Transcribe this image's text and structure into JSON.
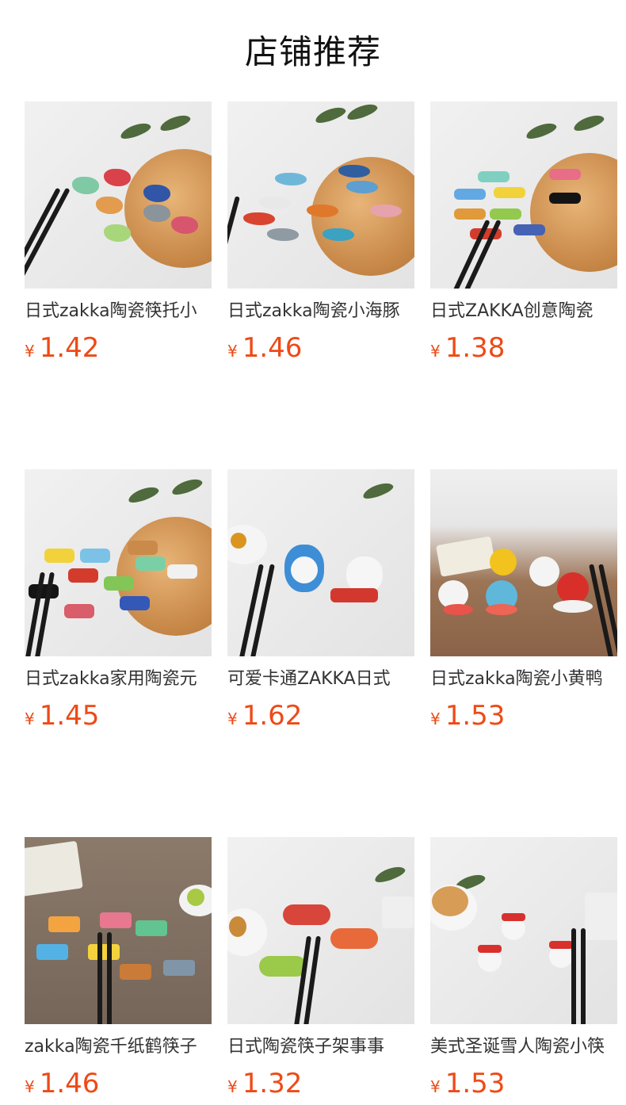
{
  "header": {
    "title": "店铺推荐"
  },
  "currency_symbol": "¥",
  "products": [
    {
      "name": "日式zakka陶瓷筷托小",
      "price": "1.42",
      "image": "fish-chopstick-rests-image",
      "bg": "light"
    },
    {
      "name": "日式zakka陶瓷小海豚",
      "price": "1.46",
      "image": "dolphin-chopstick-rests-image",
      "bg": "light"
    },
    {
      "name": "日式ZAKKA创意陶瓷",
      "price": "1.38",
      "image": "bamboo-chopstick-rests-image",
      "bg": "light"
    },
    {
      "name": "日式zakka家用陶瓷元",
      "price": "1.45",
      "image": "bow-chopstick-rests-image",
      "bg": "light"
    },
    {
      "name": "可爱卡通ZAKKA日式",
      "price": "1.62",
      "image": "cartoon-chopstick-rests-image",
      "bg": "light"
    },
    {
      "name": "日式zakka陶瓷小黄鸭",
      "price": "1.53",
      "image": "duck-chopstick-rests-image",
      "bg": "wood"
    },
    {
      "name": "zakka陶瓷千纸鹤筷子",
      "price": "1.46",
      "image": "paper-crane-chopstick-rests-image",
      "bg": "dark"
    },
    {
      "name": "日式陶瓷筷子架事事",
      "price": "1.32",
      "image": "persimmon-chopstick-rests-image",
      "bg": "light"
    },
    {
      "name": "美式圣诞雪人陶瓷小筷",
      "price": "1.53",
      "image": "snowman-chopstick-rests-image",
      "bg": "light"
    }
  ]
}
